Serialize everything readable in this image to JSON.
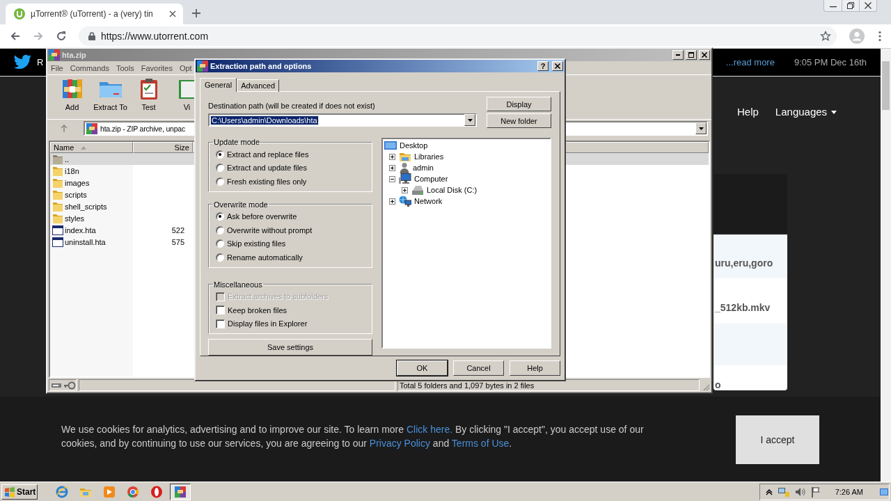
{
  "browser": {
    "tab": {
      "title": "µTorrent® (uTorrent) - a (very) tin"
    },
    "url": "https://www.utorrent.com"
  },
  "site": {
    "tweet": {
      "text": "R",
      "link": "...read more",
      "time": "9:05 PM Dec 16th"
    },
    "nav": [
      {
        "label": "Help",
        "dropdown": false
      },
      {
        "label": "Languages",
        "dropdown": true
      }
    ],
    "card_rows": [
      "uru,eru,goro",
      "_512kb.mkv",
      "o"
    ],
    "cookie": {
      "parts": [
        {
          "text": "We use cookies for analytics, advertising and to improve our site. To learn more "
        },
        {
          "text": "Click here.",
          "link": true
        },
        {
          "text": " By clicking \"I accept\", you accept use of our cookies, and by continuing to use our services, you are agreeing to our "
        },
        {
          "text": "Privacy Policy",
          "link": true
        },
        {
          "text": " and "
        },
        {
          "text": "Terms of Use",
          "link": true
        },
        {
          "text": "."
        }
      ],
      "button": "I accept"
    }
  },
  "winrar": {
    "title": "hta.zip",
    "menu": [
      "File",
      "Commands",
      "Tools",
      "Favorites",
      "Opt"
    ],
    "toolbar": [
      {
        "label": "Add",
        "kind": "archive"
      },
      {
        "label": "Extract To",
        "kind": "folder"
      },
      {
        "label": "Test",
        "kind": "clipboard"
      },
      {
        "label": "Vi",
        "kind": "book"
      }
    ],
    "address": "hta.zip - ZIP archive, unpac",
    "columns": [
      {
        "label": "Name",
        "sorted": true
      },
      {
        "label": "Size",
        "sorted": false
      }
    ],
    "files": [
      {
        "name": "..",
        "kind": "up",
        "selected": true
      },
      {
        "name": "i18n",
        "kind": "folder",
        "selected": false
      },
      {
        "name": "images",
        "kind": "folder",
        "selected": false
      },
      {
        "name": "scripts",
        "kind": "folder",
        "selected": false
      },
      {
        "name": "shell_scripts",
        "kind": "folder",
        "selected": false
      },
      {
        "name": "styles",
        "kind": "folder",
        "selected": false
      },
      {
        "name": "index.hta",
        "kind": "file",
        "size": "522",
        "selected": false
      },
      {
        "name": "uninstall.hta",
        "kind": "file",
        "size": "575",
        "selected": false
      }
    ],
    "status": "Total 5 folders and 1,097 bytes in 2 files"
  },
  "dialog": {
    "title": "Extraction path and options",
    "help_glyph": "?",
    "tabs": [
      {
        "label": "General",
        "selected": true
      },
      {
        "label": "Advanced",
        "selected": false
      }
    ],
    "path_label": "Destination path (will be created if does not exist)",
    "path_value": "C:\\Users\\admin\\Downloads\\hta",
    "side_buttons": [
      "Display",
      "New folder"
    ],
    "groups": [
      {
        "title": "Update mode",
        "options": [
          {
            "kind": "radio",
            "label": "Extract and replace files",
            "checked": true,
            "disabled": false
          },
          {
            "kind": "radio",
            "label": "Extract and update files",
            "checked": false,
            "disabled": false
          },
          {
            "kind": "radio",
            "label": "Fresh existing files only",
            "checked": false,
            "disabled": false
          }
        ]
      },
      {
        "title": "Overwrite mode",
        "options": [
          {
            "kind": "radio",
            "label": "Ask before overwrite",
            "checked": true,
            "disabled": false
          },
          {
            "kind": "radio",
            "label": "Overwrite without prompt",
            "checked": false,
            "disabled": false
          },
          {
            "kind": "radio",
            "label": "Skip existing files",
            "checked": false,
            "disabled": false
          },
          {
            "kind": "radio",
            "label": "Rename automatically",
            "checked": false,
            "disabled": false
          }
        ]
      },
      {
        "title": "Miscellaneous",
        "options": [
          {
            "kind": "checkbox",
            "label": "Extract archives to subfolders",
            "checked": false,
            "disabled": true
          },
          {
            "kind": "checkbox",
            "label": "Keep broken files",
            "checked": false,
            "disabled": false
          },
          {
            "kind": "checkbox",
            "label": "Display files in Explorer",
            "checked": false,
            "disabled": false
          }
        ]
      }
    ],
    "save_button": "Save settings",
    "tree": [
      {
        "label": "Desktop",
        "kind": "desktop",
        "children": [
          {
            "label": "Libraries",
            "kind": "libraries",
            "expanded": false
          },
          {
            "label": "admin",
            "kind": "user",
            "expanded": false
          },
          {
            "label": "Computer",
            "kind": "computer",
            "expanded": true,
            "children": [
              {
                "label": "Local Disk (C:)",
                "kind": "disk",
                "expanded": false
              }
            ]
          },
          {
            "label": "Network",
            "kind": "network",
            "expanded": false
          }
        ]
      }
    ],
    "buttons": [
      {
        "label": "OK",
        "default": true
      },
      {
        "label": "Cancel",
        "default": false
      },
      {
        "label": "Help",
        "default": false
      }
    ]
  },
  "taskbar": {
    "start": "Start",
    "apps": [
      {
        "kind": "ie",
        "active": false
      },
      {
        "kind": "explorer",
        "active": false
      },
      {
        "kind": "media",
        "active": false
      },
      {
        "kind": "chrome",
        "active": false
      },
      {
        "kind": "opera",
        "active": false
      },
      {
        "kind": "winrar",
        "active": true
      }
    ],
    "clock": "7:26 AM"
  }
}
